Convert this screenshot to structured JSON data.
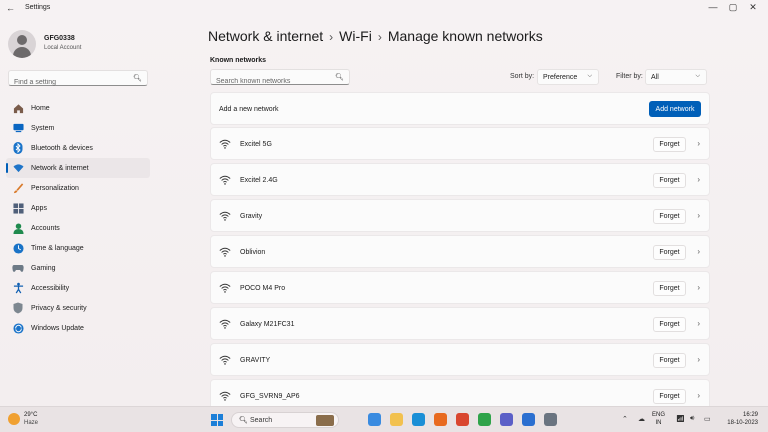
{
  "window": {
    "title": "Settings",
    "back_glyph": "←",
    "controls": [
      "—",
      "▢",
      "✕"
    ]
  },
  "account": {
    "name": "GFG0338",
    "type": "Local Account"
  },
  "sidebar": {
    "search_placeholder": "Find a setting",
    "items": [
      {
        "label": "Home",
        "icon": "home-icon",
        "color": "#7a5c4b"
      },
      {
        "label": "System",
        "icon": "system-icon",
        "color": "#0a66c2"
      },
      {
        "label": "Bluetooth & devices",
        "icon": "bluetooth-icon",
        "color": "#1a73c9"
      },
      {
        "label": "Network & internet",
        "icon": "network-icon",
        "color": "#1e74c8"
      },
      {
        "label": "Personalization",
        "icon": "brush-icon",
        "color": "#d97a2b"
      },
      {
        "label": "Apps",
        "icon": "apps-icon",
        "color": "#50607a"
      },
      {
        "label": "Accounts",
        "icon": "accounts-icon",
        "color": "#1f8a4e"
      },
      {
        "label": "Time & language",
        "icon": "globe-icon",
        "color": "#1973c7"
      },
      {
        "label": "Gaming",
        "icon": "gaming-icon",
        "color": "#6d7a86"
      },
      {
        "label": "Accessibility",
        "icon": "accessibility-icon",
        "color": "#1260b2"
      },
      {
        "label": "Privacy & security",
        "icon": "shield-icon",
        "color": "#7d8790"
      },
      {
        "label": "Windows Update",
        "icon": "update-icon",
        "color": "#1a73c9"
      }
    ],
    "active_index": 3
  },
  "breadcrumb": {
    "items": [
      "Network & internet",
      "Wi-Fi",
      "Manage known networks"
    ],
    "separator": "›"
  },
  "known": {
    "section_label": "Known networks",
    "search_placeholder": "Search known networks",
    "sort_label": "Sort by:",
    "sort_value": "Preference",
    "filter_label": "Filter by:",
    "filter_value": "All",
    "add_label": "Add a new network",
    "add_button": "Add network",
    "forget_label": "Forget",
    "networks": [
      {
        "name": "Excitel 5G"
      },
      {
        "name": "Excitel 2.4G"
      },
      {
        "name": "Gravity"
      },
      {
        "name": "Oblivion"
      },
      {
        "name": "POCO M4 Pro"
      },
      {
        "name": "Galaxy M21FC31"
      },
      {
        "name": "GRAVITY"
      },
      {
        "name": "GFG_SVRN9_AP6"
      }
    ]
  },
  "taskbar": {
    "temperature": "29°C",
    "condition": "Haze",
    "search_label": "Search",
    "language_top": "ENG",
    "language_bottom": "IN",
    "time": "16:29",
    "date": "18-10-2023",
    "apps": [
      {
        "icon": "copilot-icon",
        "color": "#3a8be0"
      },
      {
        "icon": "file-explorer-icon",
        "color": "#f2c14e"
      },
      {
        "icon": "edge-icon",
        "color": "#1a8fd6"
      },
      {
        "icon": "firefox-icon",
        "color": "#e86a1f"
      },
      {
        "icon": "office-icon",
        "color": "#d9462f"
      },
      {
        "icon": "chrome-icon",
        "color": "#2fa34a"
      },
      {
        "icon": "teams-icon",
        "color": "#5b5fc7"
      },
      {
        "icon": "store-icon",
        "color": "#2b6fd0"
      },
      {
        "icon": "settings-icon",
        "color": "#6a7480"
      }
    ]
  }
}
